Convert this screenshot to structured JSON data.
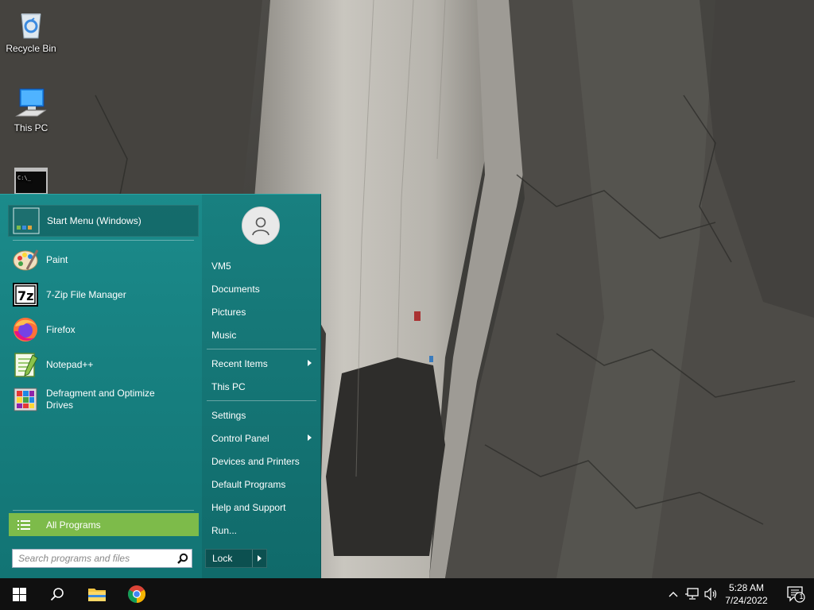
{
  "desktop": {
    "icons": [
      {
        "label": "Recycle Bin",
        "icon": "recycle-bin-icon"
      },
      {
        "label": "This PC",
        "icon": "computer-icon"
      },
      {
        "label": "",
        "icon": "command-prompt-icon"
      }
    ]
  },
  "start_menu": {
    "pinned": {
      "label": "Start Menu (Windows)",
      "icon_text": "Start"
    },
    "apps": [
      {
        "label": "Paint",
        "icon": "paint-icon"
      },
      {
        "label": "7-Zip File Manager",
        "icon": "7zip-icon"
      },
      {
        "label": "Firefox",
        "icon": "firefox-icon"
      },
      {
        "label": "Notepad++",
        "icon": "notepadpp-icon"
      },
      {
        "label": "Defragment and Optimize Drives",
        "icon": "defrag-icon"
      }
    ],
    "all_programs": "All Programs",
    "search_placeholder": "Search programs and files",
    "right": {
      "user": "VM5",
      "group1": [
        "Documents",
        "Pictures",
        "Music"
      ],
      "recent_items": "Recent Items",
      "this_pc": "This PC",
      "settings": "Settings",
      "control_panel": "Control Panel",
      "devices": "Devices and Printers",
      "default_programs": "Default Programs",
      "help": "Help and Support",
      "run": "Run..."
    },
    "lock": "Lock",
    "accent_color": "#178080",
    "all_programs_color": "#7dbb4a"
  },
  "taskbar": {
    "time": "5:28 AM",
    "date": "7/24/2022",
    "notification_count": "1"
  }
}
